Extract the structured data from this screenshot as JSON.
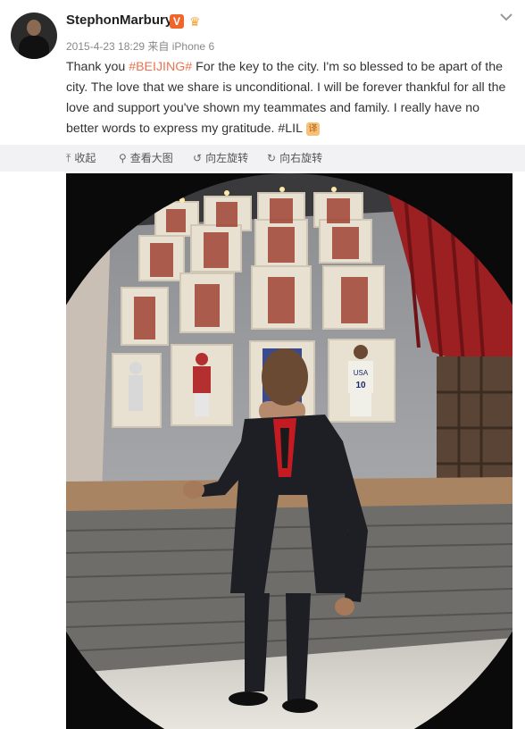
{
  "post": {
    "username": "StephonMarbury",
    "verified_badge": "V",
    "vip_badge_icon": "crown-icon",
    "meta": "2015-4-23 18:29 来自 iPhone 6",
    "text_part1": "Thank you ",
    "hashtag": "#BEIJING#",
    "text_part2": " For the key to the city. I'm so blessed to be apart of the city. The love that we share is unconditional. I will be forever thankful for all the love and support you've shown my teammates and family. I really have no better words to express my gratitude. #LIL",
    "emoji_glyph": "译"
  },
  "toolbar": {
    "collapse": "收起",
    "view_large": "查看大图",
    "rotate_left": "向左旋转",
    "rotate_right": "向右旋转"
  },
  "photo": {
    "jersey_number": "10",
    "jersey_text": "USA"
  },
  "colors": {
    "hashtag": "#eb7350",
    "toolbar_bg": "#f2f2f5",
    "badge": "#f0652a"
  }
}
